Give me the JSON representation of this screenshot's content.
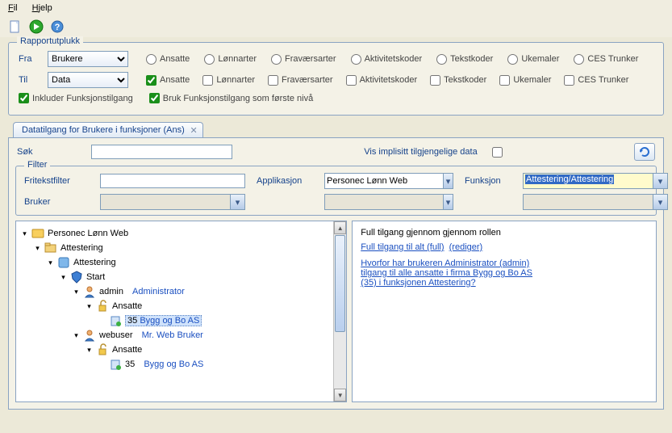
{
  "menu": {
    "file": "Fil",
    "help": "Hjelp"
  },
  "rapport": {
    "legend": "Rapportutplukk",
    "fra_label": "Fra",
    "til_label": "Til",
    "fra_value": "Brukere",
    "til_value": "Data",
    "radios": [
      "Ansatte",
      "Lønnarter",
      "Fraværsarter",
      "Aktivitetskoder",
      "Tekstkoder",
      "Ukemaler",
      "CES Trunker"
    ],
    "checks": [
      "Ansatte",
      "Lønnarter",
      "Fraværsarter",
      "Aktivitetskoder",
      "Tekstkoder",
      "Ukemaler",
      "CES Trunker"
    ],
    "checks_state": [
      true,
      false,
      false,
      false,
      false,
      false,
      false
    ],
    "inkluder": "Inkluder Funksjonstilgang",
    "bruk": "Bruk Funksjonstilgang som første nivå"
  },
  "tab": {
    "title": "Datatilgang for Brukere i funksjoner (Ans)"
  },
  "search": {
    "label": "Søk",
    "vis_label": "Vis implisitt tilgjengelige data"
  },
  "filter": {
    "legend": "Filter",
    "fritekst": "Fritekstfilter",
    "applikasjon": "Applikasjon",
    "applikasjon_value": "Personec Lønn Web",
    "funksjon": "Funksjon",
    "funksjon_value": "Attestering/Attestering",
    "bruker": "Bruker"
  },
  "tree": {
    "root": "Personec Lønn Web",
    "l1": "Attestering",
    "l2": "Attestering",
    "l3": "Start",
    "user1": "admin",
    "user1_name": "Administrator",
    "user2": "webuser",
    "user2_name": "Mr. Web Bruker",
    "ansatte": "Ansatte",
    "firm_num": "35",
    "firm": "Bygg og Bo AS"
  },
  "detail": {
    "title": "Full tilgang gjennom gjennom rollen",
    "link1": "Full tilgang til alt (full)",
    "rediger": "(rediger)",
    "q": "Hvorfor har brukeren Administrator (admin) tilgang til alle ansatte i firma Bygg og Bo AS (35) i funksjonen Attestering?"
  }
}
